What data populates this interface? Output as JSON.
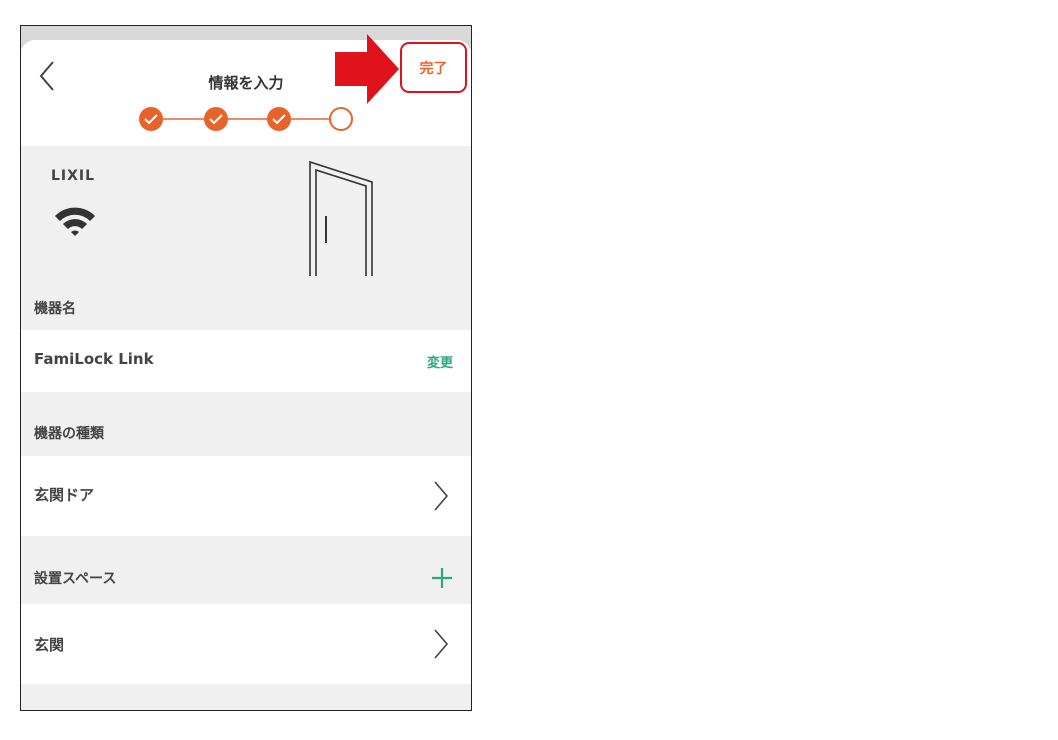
{
  "header": {
    "title": "情報を入力",
    "done_label": "完了",
    "steps": [
      {
        "state": "done"
      },
      {
        "state": "done"
      },
      {
        "state": "done"
      },
      {
        "state": "current"
      }
    ]
  },
  "device": {
    "brand": "LIXIL"
  },
  "sections": {
    "device_name_label": "機器名",
    "device_name_value": "FamiLock Link",
    "device_name_action": "変更",
    "device_type_label": "機器の種類",
    "device_type_value": "玄関ドア",
    "space_label": "設置スペース",
    "space_value": "玄関"
  },
  "colors": {
    "accent_orange": "#e8632a",
    "accent_green": "#2aa87a",
    "highlight_red": "#e0121b"
  },
  "icons": {
    "back": "chevron-left-icon",
    "wifi": "wifi-icon",
    "door": "door-icon",
    "chevron": "chevron-right-icon",
    "plus": "plus-icon",
    "arrow": "arrow-right-icon"
  }
}
